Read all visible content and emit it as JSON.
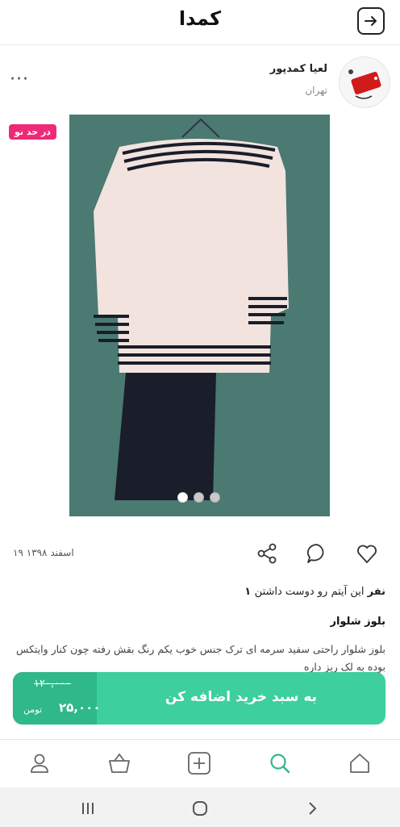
{
  "header": {
    "logo": "کمدا",
    "back_icon": "arrow-right-box-icon"
  },
  "seller": {
    "name": "لعیا کمدپور",
    "city": "تهران",
    "avatar_icon": "shop-sale-tag-icon",
    "more_icon": "more-dots-icon",
    "more_label": "···"
  },
  "product": {
    "condition_badge": "در حد نو",
    "image_count": 3,
    "active_image": 1,
    "date": "۱۹ اسفند ۱۳۹۸",
    "likes_count": "۱ نفر",
    "likes_text": "این آیتم رو دوست داشتن",
    "title": "بلوز شلوار",
    "description": "بلوز شلوار راحتی سفید سرمه ای ترک جنس خوب یکم رنگ بقش رفته چون کنار وایتکس بوده به لک ریز داره"
  },
  "actions": {
    "like_icon": "heart-icon",
    "comment_icon": "chat-bubble-icon",
    "share_icon": "share-icon"
  },
  "buy": {
    "old_price": "۱۲۰,۰۰۰",
    "new_price": "۲۵,۰۰۰",
    "unit": "تومن",
    "cta": "به سبد خرید اضافه کن"
  },
  "bottom_nav": [
    "home-icon",
    "search-icon",
    "add-listing-icon",
    "basket-icon",
    "profile-icon"
  ],
  "colors": {
    "accent": "#3ecf9f",
    "accent_dark": "#2fb88a",
    "badge": "#ee2a78",
    "photo_bg": "#4a7a72"
  }
}
